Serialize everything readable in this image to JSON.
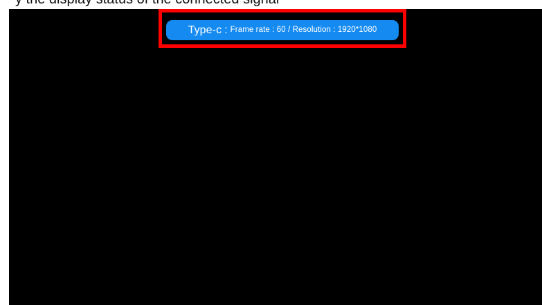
{
  "caption": {
    "text": "y the display status of the connected signal"
  },
  "status": {
    "source_label": "Type-c",
    "separator": ":",
    "detail": "Frame rate : 60 / Resolution : 1920*1080"
  },
  "colors": {
    "screen": "#000000",
    "pill": "#158bf2",
    "highlight": "#ff0000",
    "text": "#ffffff"
  }
}
